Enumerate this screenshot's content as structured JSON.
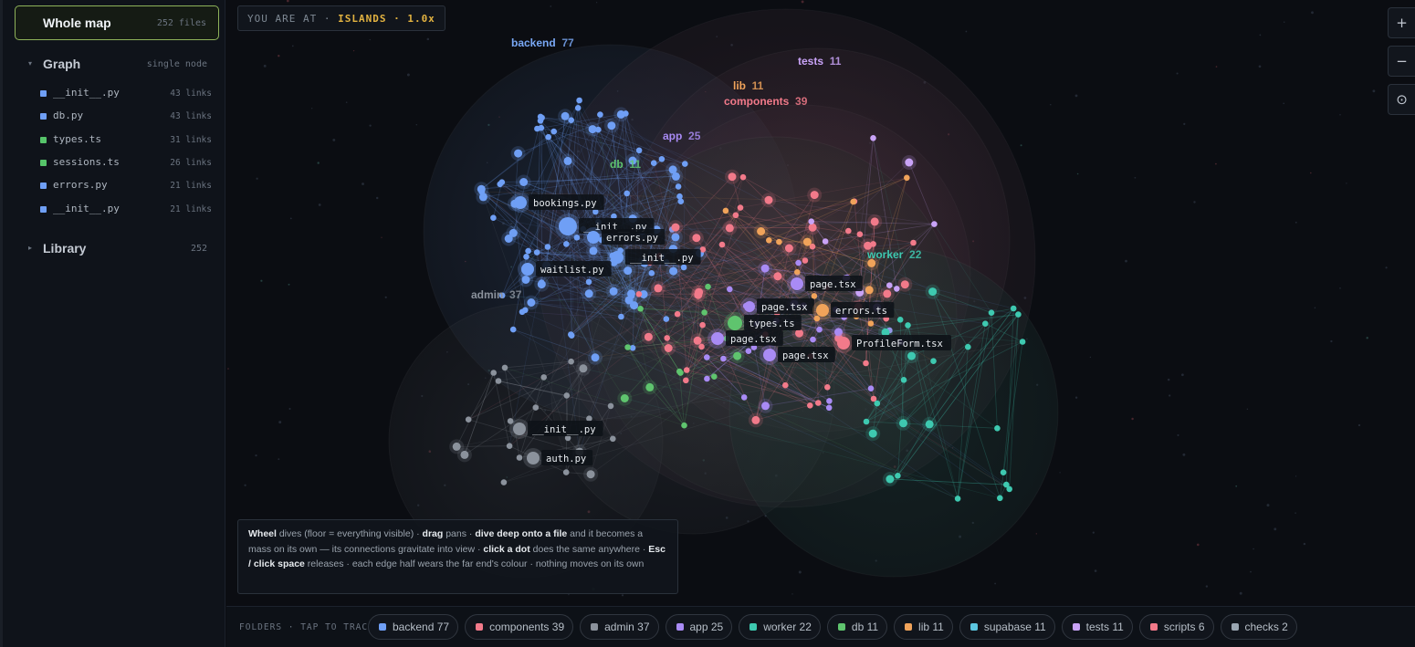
{
  "sidebar": {
    "whole_map": {
      "title": "Whole map",
      "count": "252 files"
    },
    "graph": {
      "label": "Graph",
      "meta": "single node",
      "caret": "▾"
    },
    "files": [
      {
        "name": "__init__.py",
        "links": "43 links",
        "color": "#6f9ff5"
      },
      {
        "name": "db.py",
        "links": "43 links",
        "color": "#6f9ff5"
      },
      {
        "name": "types.ts",
        "links": "31 links",
        "color": "#56c46a"
      },
      {
        "name": "sessions.ts",
        "links": "26 links",
        "color": "#56c46a"
      },
      {
        "name": "errors.py",
        "links": "21 links",
        "color": "#6f9ff5"
      },
      {
        "name": "__init__.py",
        "links": "21 links",
        "color": "#6f9ff5"
      }
    ],
    "library": {
      "label": "Library",
      "meta": "252",
      "caret": "▸"
    }
  },
  "location": {
    "prefix": "YOU ARE AT · ",
    "value": "ISLANDS · 1.0x"
  },
  "zoom": {
    "in": "+",
    "out": "−",
    "reset": "⊙"
  },
  "clusters": [
    {
      "name": "backend",
      "count": "77",
      "color": "#79a8f5"
    },
    {
      "name": "tests",
      "count": "11",
      "color": "#c9a3f7"
    },
    {
      "name": "lib",
      "count": "11",
      "color": "#f0a35a"
    },
    {
      "name": "components",
      "count": "39",
      "color": "#f27a8a"
    },
    {
      "name": "app",
      "count": "25",
      "color": "#a98bf5"
    },
    {
      "name": "db",
      "count": "11",
      "color": "#5fc46e"
    },
    {
      "name": "worker",
      "count": "22",
      "color": "#3ec9b0"
    },
    {
      "name": "admin",
      "count": "37",
      "color": "#8b929c"
    }
  ],
  "node_labels": [
    "bookings.py",
    "__init__.py",
    "errors.py",
    "__init__.py",
    "waitlist.py",
    "page.tsx",
    "page.tsx",
    "errors.ts",
    "types.ts",
    "page.tsx",
    "page.tsx",
    "ProfileForm.tsx",
    "__init__.py",
    "auth.py"
  ],
  "help": {
    "t1": "Wheel",
    "t2": " dives (floor = everything visible) · ",
    "t3": "drag",
    "t4": " pans · ",
    "t5": "dive deep onto a file",
    "t6": " and it becomes a mass on its own — its connections gravitate into view · ",
    "t7": "click a dot",
    "t8": " does the same anywhere · ",
    "t9": "Esc / click space",
    "t10": " releases · each edge half wears the far end's colour · nothing moves on its own"
  },
  "folders": {
    "label": "FOLDERS · TAP TO TRACE",
    "items": [
      {
        "name": "backend 77",
        "color": "#6f9ff5"
      },
      {
        "name": "components 39",
        "color": "#f27a8a"
      },
      {
        "name": "admin 37",
        "color": "#8b929c"
      },
      {
        "name": "app 25",
        "color": "#a98bf5"
      },
      {
        "name": "worker 22",
        "color": "#3ec9b0"
      },
      {
        "name": "db 11",
        "color": "#5fc46e"
      },
      {
        "name": "lib 11",
        "color": "#f0a35a"
      },
      {
        "name": "supabase 11",
        "color": "#5cc6e0"
      },
      {
        "name": "tests 11",
        "color": "#c9a3f7"
      },
      {
        "name": "scripts 6",
        "color": "#f27a8a"
      },
      {
        "name": "checks 2",
        "color": "#9aa6b2"
      }
    ]
  }
}
